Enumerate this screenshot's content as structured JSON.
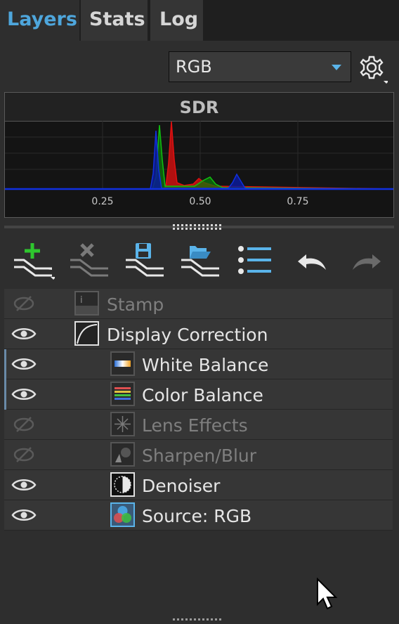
{
  "tabs": [
    {
      "label": "Layers",
      "active": true
    },
    {
      "label": "Stats",
      "active": false
    },
    {
      "label": "Log",
      "active": false
    }
  ],
  "channel_select": {
    "value": "RGB"
  },
  "histogram": {
    "title": "SDR",
    "ticks": [
      "0.25",
      "0.50",
      "0.75"
    ]
  },
  "toolbar": {
    "icons": [
      "add-layer-icon",
      "delete-layer-icon",
      "save-layer-icon",
      "open-layer-icon",
      "list-menu-icon",
      "undo-icon",
      "redo-icon"
    ]
  },
  "layers": [
    {
      "name": "Stamp",
      "visible": false,
      "indent": 0,
      "icon": "stamp-icon"
    },
    {
      "name": "Display Correction",
      "visible": true,
      "indent": 0,
      "icon": "curve-icon"
    },
    {
      "name": "White Balance",
      "visible": true,
      "indent": 1,
      "icon": "white-balance-icon",
      "selected": true
    },
    {
      "name": "Color Balance",
      "visible": true,
      "indent": 1,
      "icon": "color-balance-icon",
      "selected": true
    },
    {
      "name": "Lens Effects",
      "visible": false,
      "indent": 1,
      "icon": "lens-effects-icon"
    },
    {
      "name": "Sharpen/Blur",
      "visible": false,
      "indent": 1,
      "icon": "sharpen-blur-icon"
    },
    {
      "name": "Denoiser",
      "visible": true,
      "indent": 1,
      "icon": "denoiser-icon"
    },
    {
      "name": "Source: RGB",
      "visible": true,
      "indent": 1,
      "icon": "source-rgb-icon"
    }
  ],
  "colors": {
    "accent": "#4ea6dc",
    "red": "#e01010",
    "green": "#10c010",
    "blue": "#1030e0"
  }
}
